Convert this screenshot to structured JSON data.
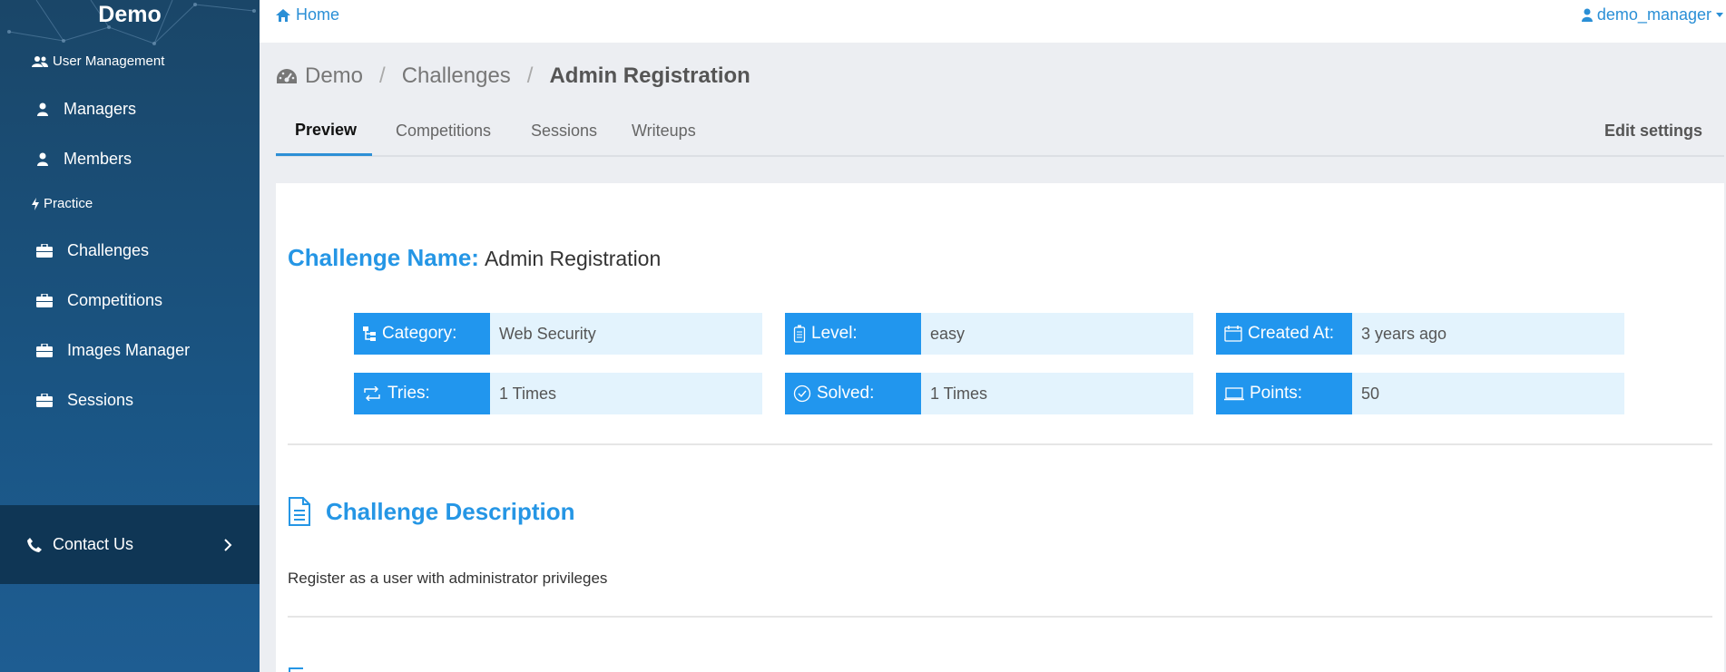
{
  "sidebar": {
    "brand": "Demo",
    "sections": [
      {
        "label": "User Management",
        "icon": "users-icon",
        "items": [
          {
            "label": "Managers",
            "icon": "user-icon"
          },
          {
            "label": "Members",
            "icon": "user-icon"
          }
        ]
      },
      {
        "label": "Practice",
        "icon": "bolt-icon",
        "items": [
          {
            "label": "Challenges",
            "icon": "briefcase-icon"
          },
          {
            "label": "Competitions",
            "icon": "briefcase-icon"
          },
          {
            "label": "Images Manager",
            "icon": "briefcase-icon"
          },
          {
            "label": "Sessions",
            "icon": "briefcase-icon"
          }
        ]
      }
    ],
    "contact": {
      "label": "Contact Us",
      "icon": "phone-icon"
    }
  },
  "topbar": {
    "home_label": "Home",
    "user_label": "demo_manager"
  },
  "breadcrumb": {
    "items": [
      "Demo",
      "Challenges",
      "Admin Registration"
    ]
  },
  "tabs": {
    "items": [
      "Preview",
      "Competitions",
      "Sessions",
      "Writeups"
    ],
    "active": "Preview",
    "edit_label": "Edit settings"
  },
  "challenge": {
    "name_label": "Challenge Name:",
    "name": "Admin Registration",
    "info": [
      {
        "label": "Category:",
        "value": "Web Security",
        "icon": "sitemap-icon"
      },
      {
        "label": "Level:",
        "value": "easy",
        "icon": "battery-icon"
      },
      {
        "label": "Created At:",
        "value": "3 years ago",
        "icon": "calendar-icon"
      },
      {
        "label": "Tries:",
        "value": "1 Times",
        "icon": "retweet-icon"
      },
      {
        "label": "Solved:",
        "value": "1 Times",
        "icon": "check-circle-icon"
      },
      {
        "label": "Points:",
        "value": "50",
        "icon": "monitor-icon"
      }
    ],
    "description_title": "Challenge Description",
    "description": "Register as a user with administrator privileges"
  },
  "colors": {
    "accent": "#2196ee",
    "title": "#2596e5",
    "sidebar_dark": "#0f3655"
  }
}
